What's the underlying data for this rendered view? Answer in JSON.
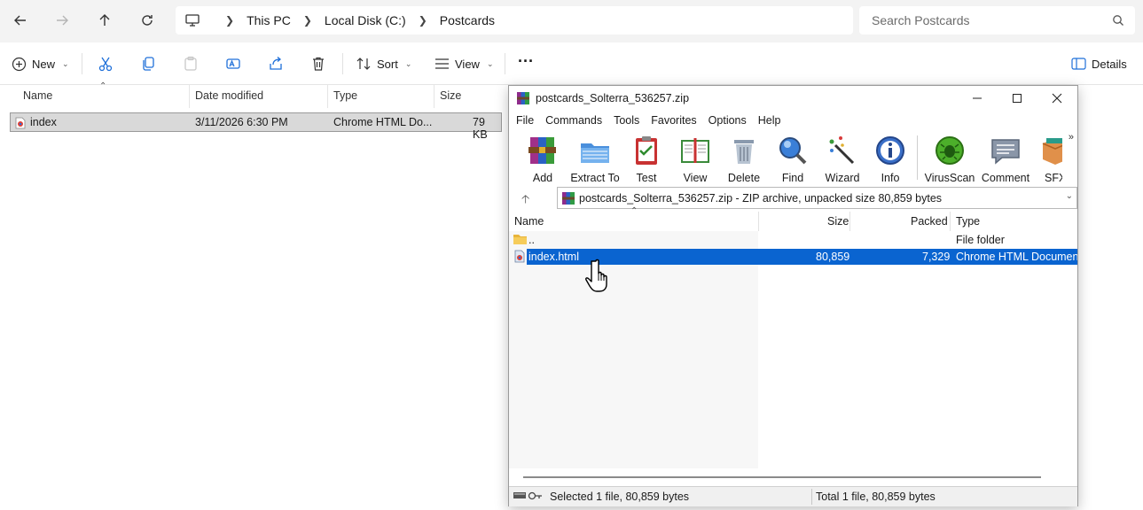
{
  "explorer": {
    "breadcrumbs": [
      "This PC",
      "Local Disk (C:)",
      "Postcards"
    ],
    "search_placeholder": "Search Postcards",
    "commands": {
      "new": "New",
      "sort": "Sort",
      "view": "View",
      "more": "···",
      "details": "Details"
    },
    "columns": [
      "Name",
      "Date modified",
      "Type",
      "Size"
    ],
    "files": [
      {
        "name": "index",
        "date": "3/11/2026 6:30 PM",
        "type": "Chrome HTML Do...",
        "size": "79 KB"
      }
    ]
  },
  "winrar": {
    "title": "postcards_Solterra_536257.zip",
    "menu": [
      "File",
      "Commands",
      "Tools",
      "Favorites",
      "Options",
      "Help"
    ],
    "tools": [
      "Add",
      "Extract To",
      "Test",
      "View",
      "Delete",
      "Find",
      "Wizard",
      "Info",
      "VirusScan",
      "Comment",
      "SFX"
    ],
    "path_text": "postcards_Solterra_536257.zip - ZIP archive, unpacked size 80,859 bytes",
    "columns": [
      "Name",
      "Size",
      "Packed",
      "Type"
    ],
    "rows": [
      {
        "name": "..",
        "size": "",
        "packed": "",
        "type": "File folder"
      },
      {
        "name": "index.html",
        "size": "80,859",
        "packed": "7,329",
        "type": "Chrome HTML Document"
      }
    ],
    "status_left": "Selected 1 file, 80,859 bytes",
    "status_right": "Total 1 file, 80,859 bytes"
  },
  "colors": {
    "selection": "#0a64d0",
    "explorer_selection": "#d9d9d9",
    "accent_blue": "#1e6fd9"
  }
}
